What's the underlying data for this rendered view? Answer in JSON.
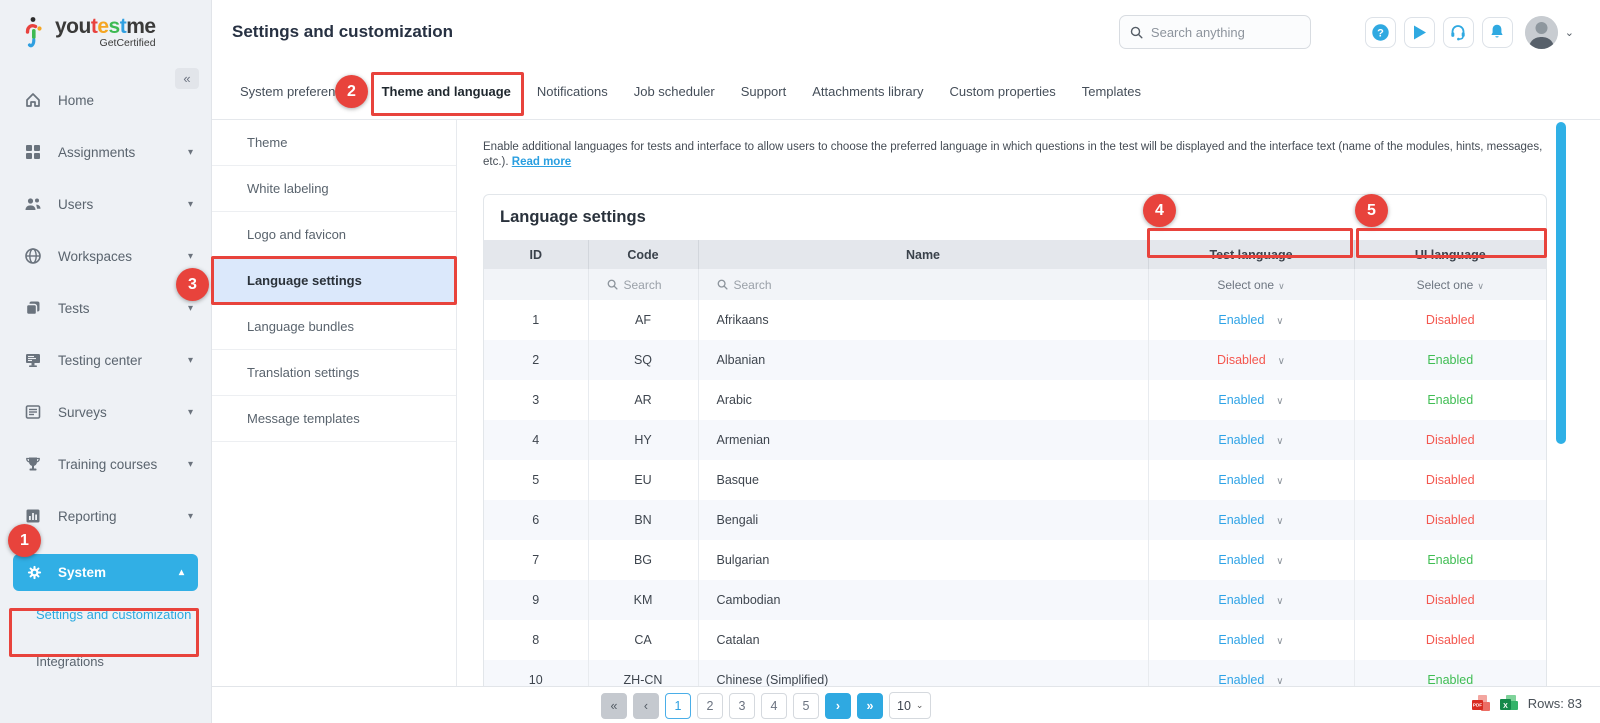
{
  "brand": {
    "seg1": "you",
    "seg2": "t",
    "seg3": "e",
    "seg4": "s",
    "seg5": "t",
    "seg6": "me",
    "subtitle": "GetCertified"
  },
  "header": {
    "title": "Settings and customization",
    "search_placeholder": "Search anything",
    "icons": [
      "help-icon",
      "play-icon",
      "support-headset-icon",
      "notifications-bell-icon"
    ],
    "avatar_chevron": "⌄"
  },
  "sidebar": {
    "collapse_glyph": "«",
    "items": [
      {
        "label": "Home",
        "icon": "home-icon",
        "chevron": ""
      },
      {
        "label": "Assignments",
        "icon": "assignments-icon",
        "chevron": "▾"
      },
      {
        "label": "Users",
        "icon": "users-icon",
        "chevron": "▾"
      },
      {
        "label": "Workspaces",
        "icon": "workspaces-globe-icon",
        "chevron": "▾"
      },
      {
        "label": "Tests",
        "icon": "tests-icon",
        "chevron": "▾"
      },
      {
        "label": "Testing center",
        "icon": "testing-center-icon",
        "chevron": "▾"
      },
      {
        "label": "Surveys",
        "icon": "surveys-icon",
        "chevron": "▾"
      },
      {
        "label": "Training courses",
        "icon": "training-courses-trophy-icon",
        "chevron": "▾"
      },
      {
        "label": "Reporting",
        "icon": "reporting-icon",
        "chevron": "▾"
      }
    ],
    "system": {
      "label": "System",
      "icon": "gear-icon",
      "chevron": "▴"
    },
    "sub_items": [
      "Settings and customization",
      "Integrations"
    ]
  },
  "tabs": [
    "System preferences",
    "Theme and language",
    "Notifications",
    "Job scheduler",
    "Support",
    "Attachments library",
    "Custom properties",
    "Templates"
  ],
  "active_tab": "Theme and language",
  "submenu": [
    "Theme",
    "White labeling",
    "Logo and favicon",
    "Language settings",
    "Language bundles",
    "Translation settings",
    "Message templates"
  ],
  "active_submenu": "Language settings",
  "description": {
    "text": "Enable additional languages for tests and interface to allow users to choose the preferred language in which questions in the test will be displayed and the interface text (name of the modules, hints, messages, etc.).",
    "link": "Read more"
  },
  "table": {
    "title": "Language settings",
    "columns": [
      "ID",
      "Code",
      "Name",
      "Test language",
      "UI language"
    ],
    "filter": {
      "search_placeholder": "Search",
      "select_placeholder": "Select one"
    },
    "rows": [
      {
        "id": "1",
        "code": "AF",
        "name": "Afrikaans",
        "test_language": "Enabled",
        "ui_language": "Disabled"
      },
      {
        "id": "2",
        "code": "SQ",
        "name": "Albanian",
        "test_language": "Disabled",
        "ui_language": "Enabled"
      },
      {
        "id": "3",
        "code": "AR",
        "name": "Arabic",
        "test_language": "Enabled",
        "ui_language": "Enabled"
      },
      {
        "id": "4",
        "code": "HY",
        "name": "Armenian",
        "test_language": "Enabled",
        "ui_language": "Disabled"
      },
      {
        "id": "5",
        "code": "EU",
        "name": "Basque",
        "test_language": "Enabled",
        "ui_language": "Disabled"
      },
      {
        "id": "6",
        "code": "BN",
        "name": "Bengali",
        "test_language": "Enabled",
        "ui_language": "Disabled"
      },
      {
        "id": "7",
        "code": "BG",
        "name": "Bulgarian",
        "test_language": "Enabled",
        "ui_language": "Enabled"
      },
      {
        "id": "9",
        "code": "KM",
        "name": "Cambodian",
        "test_language": "Enabled",
        "ui_language": "Disabled"
      },
      {
        "id": "8",
        "code": "CA",
        "name": "Catalan",
        "test_language": "Enabled",
        "ui_language": "Disabled"
      },
      {
        "id": "10",
        "code": "ZH-CN",
        "name": "Chinese (Simplified)",
        "test_language": "Enabled",
        "ui_language": "Enabled"
      }
    ]
  },
  "pagination": {
    "first": "«",
    "prev": "‹",
    "pages": [
      "1",
      "2",
      "3",
      "4",
      "5"
    ],
    "active_page": "1",
    "next": "›",
    "last": "»",
    "page_size": "10",
    "size_chevron": "⌄"
  },
  "footer": {
    "rows_label": "Rows: 83",
    "pdf_label": "PDF",
    "excel_label": "X"
  },
  "annotations": {
    "circles": [
      "1",
      "2",
      "3",
      "4",
      "5"
    ]
  },
  "colors": {
    "accent_blue": "#2fa9e1",
    "enabled_green": "#3fbd53",
    "disabled_red": "#f4564e",
    "annotation_red": "#e8433c",
    "sidebar_bg": "#eef1f5",
    "active_submenu_bg": "#dbe8fb"
  }
}
